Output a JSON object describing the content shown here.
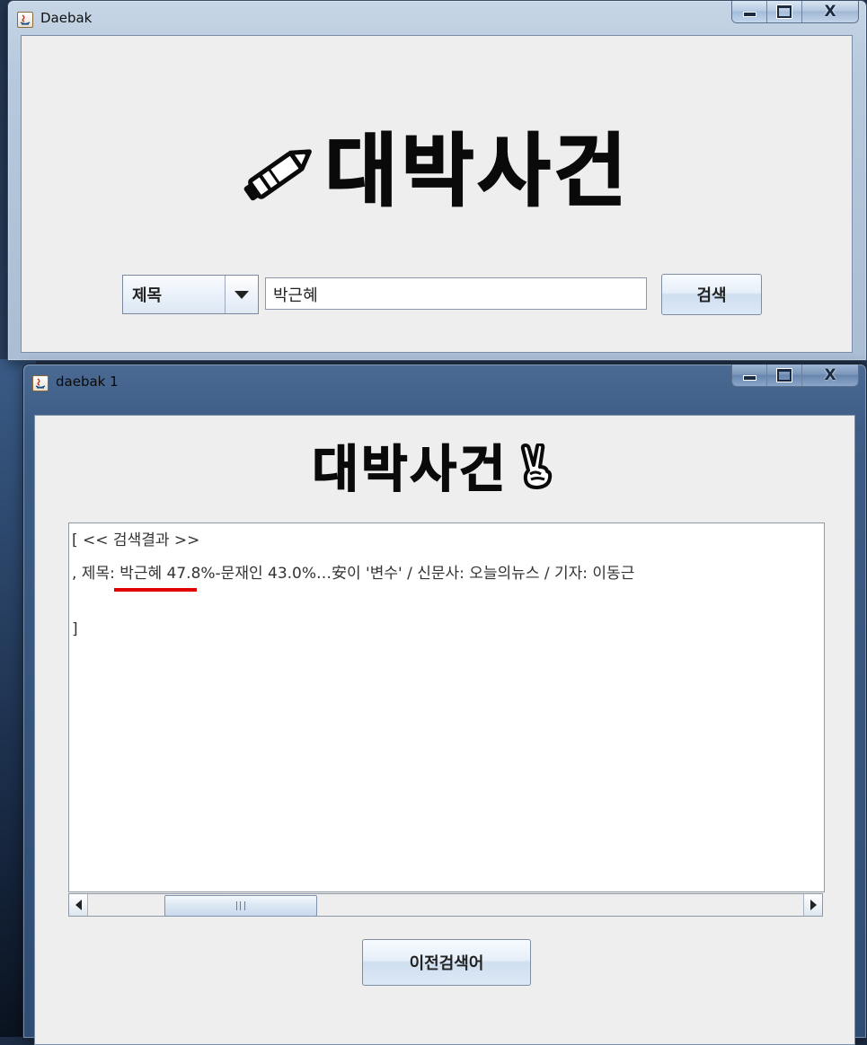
{
  "window1": {
    "title": "Daebak",
    "heading": "대박사건",
    "heading_icon": "pencil-icon",
    "search_field_combo": {
      "selected": "제목"
    },
    "search_input": {
      "value": "박근혜"
    },
    "search_button_label": "검색",
    "controls": {
      "minimize": "minimize-icon",
      "maximize": "maximize-icon",
      "close": "X"
    }
  },
  "window2": {
    "title": "daebak 1",
    "heading": "대박사건",
    "heading_icon": "victory-hand-icon",
    "result": {
      "line1": "[ << 검색결과 >>",
      "line2": ", 제목: 박근혜 47.8%-문재인 43.0%…安이 '변수' / 신문사: 오늘의뉴스 / 기자: 이동근",
      "line3": "]"
    },
    "prev_button_label": "이전검색어",
    "controls": {
      "minimize": "minimize-icon",
      "maximize": "maximize-icon",
      "close": "X"
    }
  },
  "colors": {
    "highlight_underline": "#e00000",
    "client_bg": "#eeeeee"
  }
}
